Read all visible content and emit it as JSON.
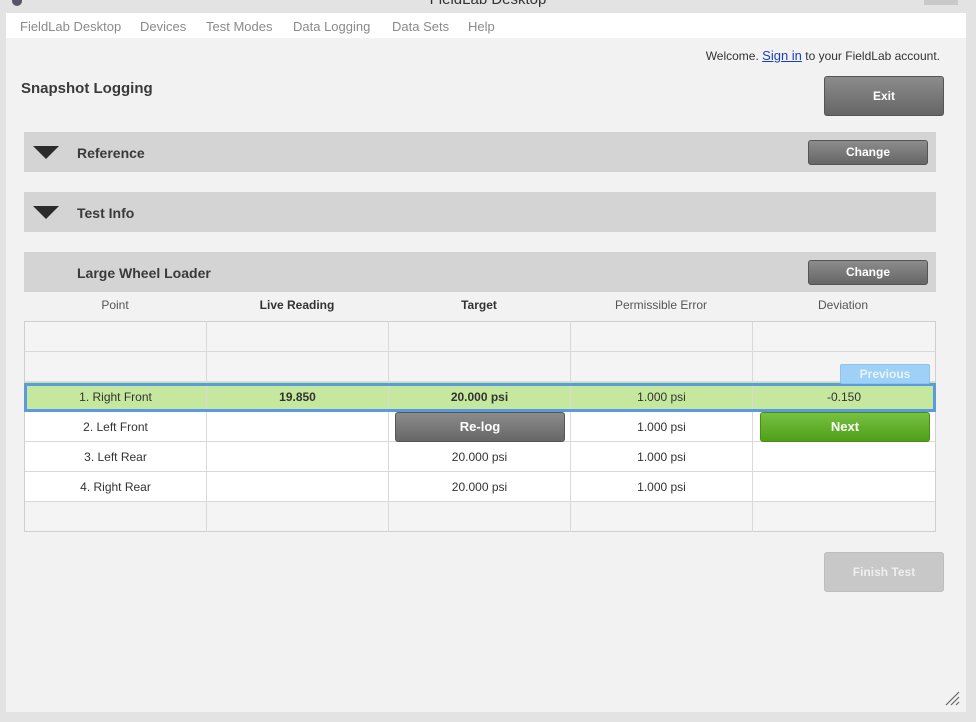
{
  "window": {
    "title": "FieldLab Desktop"
  },
  "menu": [
    "FieldLab Desktop",
    "Devices",
    "Test Modes",
    "Data Logging",
    "Data Sets",
    "Help"
  ],
  "welcome": {
    "prefix": "Welcome. ",
    "signin": "Sign in",
    "suffix": " to your FieldLab account."
  },
  "page": {
    "title": "Snapshot Logging",
    "exit": "Exit",
    "finish": "Finish Test"
  },
  "sections": {
    "reference": {
      "label": "Reference",
      "button": "Change"
    },
    "test_info": {
      "label": "Test Info"
    },
    "machine": {
      "label": "Large Wheel Loader",
      "button": "Change"
    }
  },
  "table": {
    "columns": [
      "Point",
      "Live Reading",
      "Target",
      "Permissible Error",
      "Deviation"
    ],
    "rows": [
      {
        "point": "1. Right Front",
        "live": "19.850",
        "target": "20.000 psi",
        "error": "1.000 psi",
        "deviation": "-0.150"
      },
      {
        "point": "2. Left Front",
        "live": "",
        "target": "",
        "error": "1.000 psi",
        "deviation": ""
      },
      {
        "point": "3. Left Rear",
        "live": "",
        "target": "20.000 psi",
        "error": "1.000 psi",
        "deviation": ""
      },
      {
        "point": "4. Right Rear",
        "live": "",
        "target": "20.000 psi",
        "error": "1.000 psi",
        "deviation": ""
      }
    ],
    "relog": "Re-log",
    "previous": "Previous",
    "next": "Next"
  },
  "colors": {
    "selected_row": "#c6e89e",
    "selection_border": "#5a9ae0",
    "next_button": "#5aaa22",
    "previous_button": "#9fd0f5"
  }
}
